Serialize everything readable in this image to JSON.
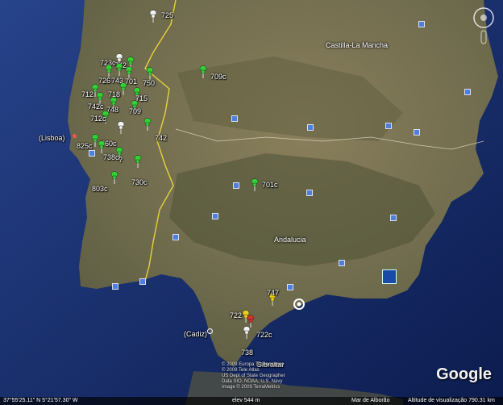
{
  "regions": {
    "castilla": "Castilla-La Mancha",
    "andalucia": "Andalucia"
  },
  "cities": {
    "lisboa": "(Lisboa)",
    "cadiz": "(Cadiz)",
    "gibraltar": "Gibraltar"
  },
  "pins": [
    {
      "label": "725",
      "color": "white"
    },
    {
      "label": "723c",
      "color": "white"
    },
    {
      "label": "742",
      "color": "green"
    },
    {
      "label": "726",
      "color": "green"
    },
    {
      "label": "743",
      "color": "green"
    },
    {
      "label": "701",
      "color": "green"
    },
    {
      "label": "750",
      "color": "green"
    },
    {
      "label": "709c",
      "color": "green"
    },
    {
      "label": "712",
      "color": "green"
    },
    {
      "label": "718",
      "color": "green"
    },
    {
      "label": "742c",
      "color": "green"
    },
    {
      "label": "748",
      "color": "green"
    },
    {
      "label": "715",
      "color": "green"
    },
    {
      "label": "709",
      "color": "green"
    },
    {
      "label": "712c",
      "color": "green"
    },
    {
      "label": "742",
      "color": "green"
    },
    {
      "label": "825c",
      "color": "green"
    },
    {
      "label": "760c",
      "color": "white"
    },
    {
      "label": "738c",
      "color": "green"
    },
    {
      "label": "?",
      "color": "green"
    },
    {
      "label": "730c",
      "color": "green"
    },
    {
      "label": "803c",
      "color": "green"
    },
    {
      "label": "701c",
      "color": "green"
    },
    {
      "label": "747",
      "color": "yellow"
    },
    {
      "label": "722",
      "color": "yellow"
    },
    {
      "label": "722c",
      "color": "red"
    },
    {
      "label": "738",
      "color": "white"
    }
  ],
  "credits": {
    "line1": "© 2009 Europa Technologies",
    "line2": "© 2009 Tele Atlas",
    "line3": "US Dept of State Geographer",
    "line4": "Data SIO, NOAA, U.S. Navy",
    "line5": "Image © 2009 TerraMetrics"
  },
  "status": {
    "coords": "37°55'25.11\" N     5°21'57.30\" W",
    "elev": "elev  544 m",
    "history": "Mar de Alborão",
    "altitude": "Altitude de visualização  790.31 km"
  },
  "logo": "Google",
  "colors": {
    "land": "#6f6a4e",
    "sea": "#1d3a7a",
    "border": "#e5d23a"
  }
}
